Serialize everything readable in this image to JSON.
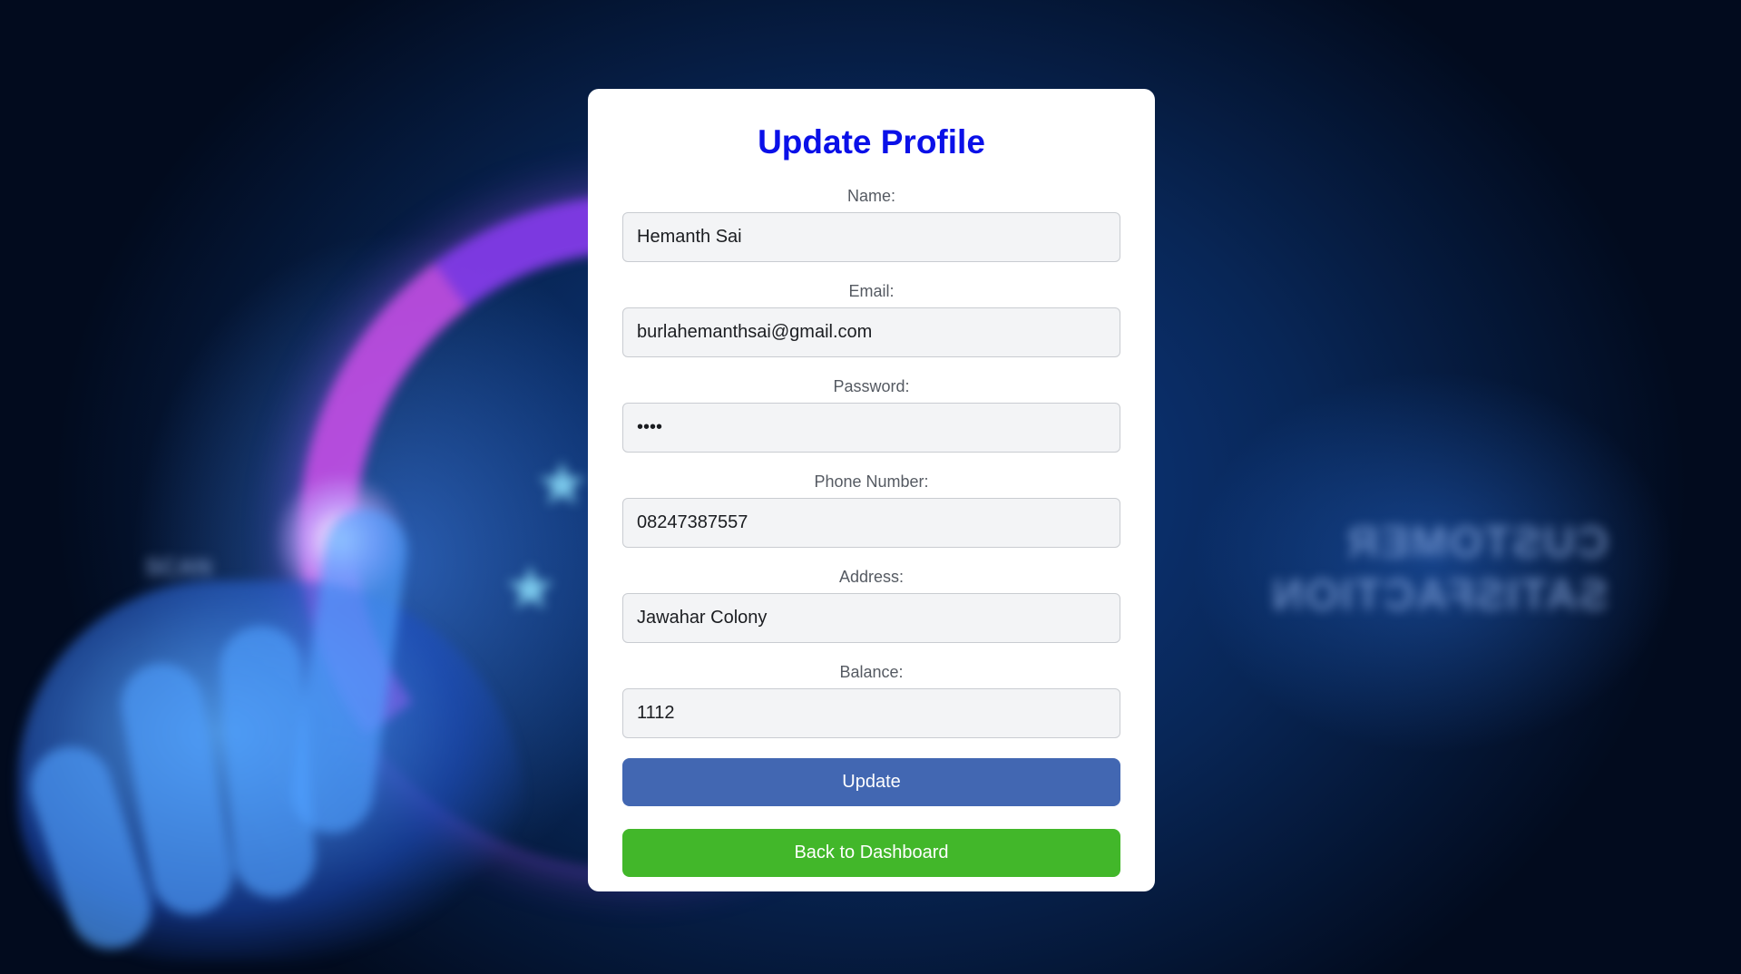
{
  "background": {
    "mirrored_text_line1": "CUSTOMER",
    "mirrored_text_line2": "SATISFACTION",
    "small_text": "SCAN"
  },
  "form": {
    "title": "Update Profile",
    "title_color": "#0a10e8",
    "fields": [
      {
        "label": "Name:",
        "value": "Hemanth Sai",
        "type": "text"
      },
      {
        "label": "Email:",
        "value": "burlahemanthsai@gmail.com",
        "type": "email"
      },
      {
        "label": "Password:",
        "value": "1234",
        "type": "password"
      },
      {
        "label": "Phone Number:",
        "value": "08247387557",
        "type": "tel"
      },
      {
        "label": "Address:",
        "value": "Jawahar Colony",
        "type": "text"
      },
      {
        "label": "Balance:",
        "value": "1112",
        "type": "text"
      }
    ],
    "update_button": {
      "label": "Update",
      "color": "#4267b2"
    },
    "back_button": {
      "label": "Back to Dashboard",
      "color": "#42b72a"
    }
  }
}
